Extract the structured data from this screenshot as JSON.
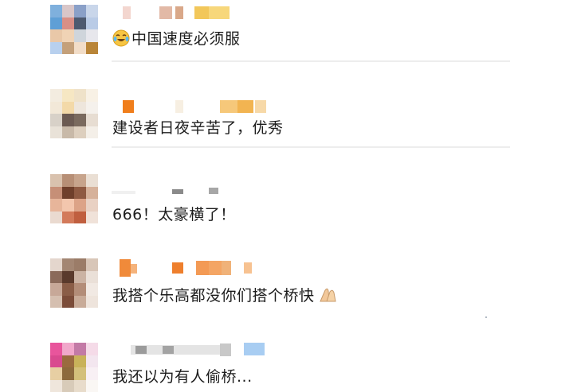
{
  "comments": [
    {
      "text": "中国速度必须服",
      "lead_emoji": "laughing-crying-emoji"
    },
    {
      "text": "建设者日夜辛苦了，优秀"
    },
    {
      "text": "666！太豪横了！"
    },
    {
      "text": "我搭个乐高都没你们搭个桥快",
      "trail_emoji": "praying-hands-emoji"
    },
    {
      "text": "我还以为有人偷桥..."
    }
  ],
  "colors": {
    "text": "#1c1c1c",
    "divider": "#ededed"
  }
}
